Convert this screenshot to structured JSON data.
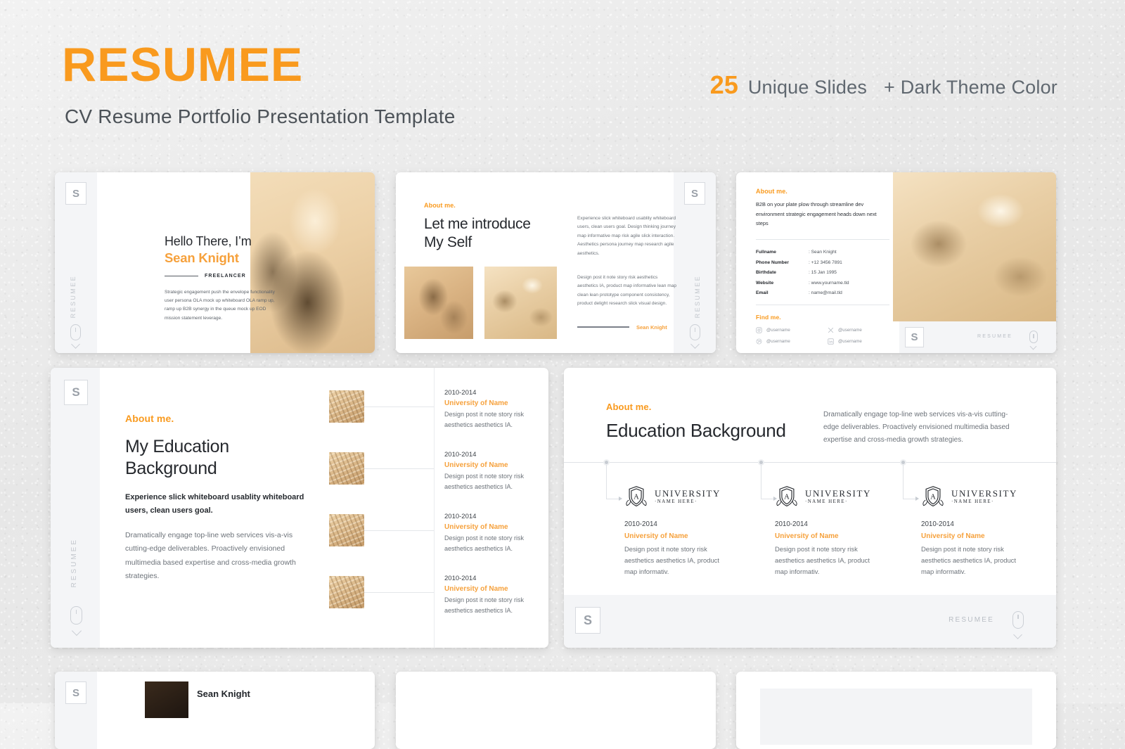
{
  "header": {
    "brand": "RESUMEE",
    "subtitle": "CV Resume Portfolio Presentation Template",
    "slide_count": "25",
    "slide_count_label": "Unique Slides",
    "theme_note": "+ Dark Theme Color",
    "accent_color": "#f99a1e",
    "text_color": "#4c5258"
  },
  "common": {
    "logo_letter": "S",
    "vertical_label": "RESUMEE",
    "footer_label": "RESUMEE",
    "mouse_icon": "mouse-scroll-icon",
    "chevron_icon": "chevron-down-icon"
  },
  "slide1": {
    "greeting": "Hello There, I’m",
    "name": "Sean Knight",
    "role": "FREELANCER",
    "paragraph": "Strategic engagement push the envelope functionality user persona OLA mock up whiteboard OLA ramp up, ramp up B2B synergy in the queue mock up EOD mission statement leverage.",
    "photo_alt": "portrait-photo-sean-knight"
  },
  "slide2": {
    "kicker": "About me.",
    "headline_line1": "Let me introduce",
    "headline_line2": "My Self",
    "paragraph1": "Experience slick whiteboard usablity whiteboard users, clean users goal. Design thinking journey map informative map risk agile slick interaction. Aesthetics persona journey map research agile aesthetics.",
    "paragraph2": "Design post it note story risk aesthetics aesthetics IA, product map informative lean map clean lean prototype component consistency, product delight research slick visual design.",
    "signature": "Sean Knight",
    "photo1_alt": "street-photo-person-sunglasses",
    "photo2_alt": "laptop-typing-photo"
  },
  "slide3": {
    "kicker": "About me.",
    "paragraph": "B2B on your plate plow through streamline dev environment strategic engagement heads down next steps",
    "details": [
      {
        "label": "Fullname",
        "value": ": Sean Knight"
      },
      {
        "label": "Phone Number",
        "value": ": +12 3456 7891"
      },
      {
        "label": "Birthdate",
        "value": ": 15 Jan 1995"
      },
      {
        "label": "Website",
        "value": ": www.yourname.tld"
      },
      {
        "label": "Email",
        "value": ": name@mail.tld"
      }
    ],
    "find_me_title": "Find me.",
    "socials": [
      {
        "icon": "instagram-icon",
        "handle": "@username"
      },
      {
        "icon": "x-twitter-icon",
        "handle": "@username"
      },
      {
        "icon": "dribbble-icon",
        "handle": "@username"
      },
      {
        "icon": "linkedin-icon",
        "handle": "@username"
      }
    ],
    "photo_alt": "desk-workspace-photo"
  },
  "slide4": {
    "kicker": "About me.",
    "headline_line1": "My Education",
    "headline_line2": "Background",
    "lead": "Experience slick whiteboard usablity whiteboard users, clean users goal.",
    "paragraph": "Dramatically engage top-line web services vis-a-vis cutting-edge deliverables. Proactively envisioned multimedia based expertise and cross-media growth strategies.",
    "timeline": [
      {
        "years": "2010-2014",
        "school": "University of Name",
        "desc": "Design post it note story risk aesthetics aesthetics IA.",
        "photo_alt": "campus-aerial-thumb"
      },
      {
        "years": "2010-2014",
        "school": "University of Name",
        "desc": "Design post it note story risk aesthetics aesthetics IA.",
        "photo_alt": "lecture-hall-thumb"
      },
      {
        "years": "2010-2014",
        "school": "University of Name",
        "desc": "Design post it note story risk aesthetics aesthetics IA.",
        "photo_alt": "graduation-thumb"
      },
      {
        "years": "2010-2014",
        "school": "University of Name",
        "desc": "Design post it note story risk aesthetics aesthetics IA.",
        "photo_alt": "library-thumb"
      }
    ]
  },
  "slide5": {
    "kicker": "About me.",
    "headline": "Education Background",
    "paragraph": "Dramatically engage top-line web services vis-a-vis cutting-edge deliverables. Proactively envisioned multimedia based expertise and cross-media growth strategies.",
    "crest_title": "UNIVERSITY",
    "crest_subtitle": "·NAME HERE·",
    "crest_letter": "A",
    "items": [
      {
        "years": "2010-2014",
        "school": "University of Name",
        "desc": "Design post it note story risk aesthetics aesthetics IA, product map informativ."
      },
      {
        "years": "2010-2014",
        "school": "University of Name",
        "desc": "Design post it note story risk aesthetics aesthetics IA, product map informativ."
      },
      {
        "years": "2010-2014",
        "school": "University of Name",
        "desc": "Design post it note story risk aesthetics aesthetics IA, product map informativ."
      }
    ]
  },
  "slide6": {
    "name": "Sean Knight"
  }
}
